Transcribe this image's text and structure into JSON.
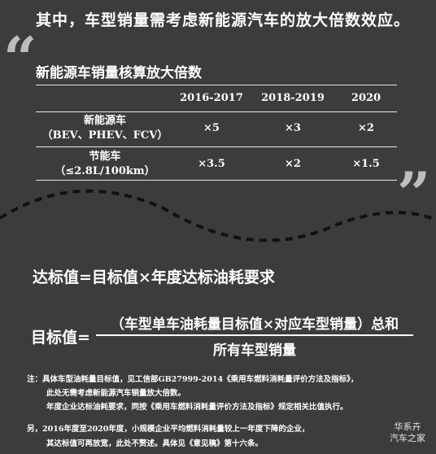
{
  "headline": "其中，车型销量需考虑新能源汽车的放大倍数效应。",
  "quote": {
    "open": "“",
    "close": "”"
  },
  "table": {
    "title": "新能源车销量核算放大倍数",
    "columns": [
      "2016-2017",
      "2018-2019",
      "2020"
    ],
    "rows": [
      {
        "name": "新能源车",
        "sub": "（BEV、PHEV、FCV）",
        "values": [
          "×5",
          "×3",
          "×2"
        ]
      },
      {
        "name": "节能车",
        "sub": "（≤2.8L/100km）",
        "values": [
          "×3.5",
          "×2",
          "×1.5"
        ]
      }
    ]
  },
  "formula1": "达标值=目标值×年度达标油耗要求",
  "formula2": {
    "label": "目标值=",
    "numerator": "（车型单车油耗量目标值×对应车型销量）总和",
    "denominator": "所有车型销量"
  },
  "notes": {
    "line1": "注：具体车型油耗量目标值，见工信部GB27999-2014《乘用车燃料消耗量评价方法及指标》，",
    "line2": "此处无需考虑新能源汽车销量放大倍数。",
    "line3": "年度企业达标油耗要求，同按《乘用车燃料消耗量评价方法及指标》规定相关比值执行。",
    "line4": "另，2016年度至2020年度，小规模企业平均燃料消耗量较上一年度下降的企业，",
    "line5": "其达标值可再放宽，此处不赘述。具体见《意见稿》第十六条。"
  },
  "watermark": {
    "line1": "华系卉",
    "line2": "汽车之家"
  },
  "colors": {
    "background": "#3c3c3c",
    "text": "#ffffff",
    "quote_marks": "#bdbdbd"
  }
}
